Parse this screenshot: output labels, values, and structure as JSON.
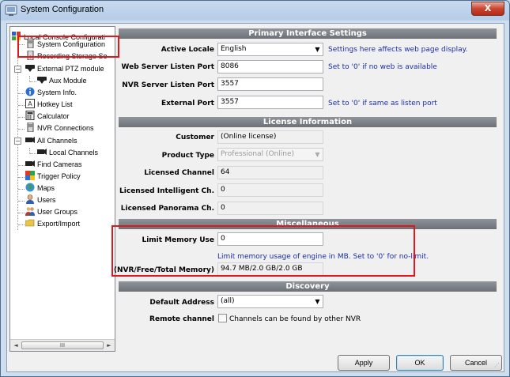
{
  "window": {
    "title": "System Configuration",
    "close_label": "X"
  },
  "tree": {
    "items": [
      {
        "label": "Local Console Configurati",
        "icon": "console-config-icon"
      },
      {
        "label": "System Configuration",
        "icon": "server-icon"
      },
      {
        "label": "Recording Storage Se",
        "icon": "storage-icon"
      },
      {
        "label": "External PTZ module",
        "icon": "ptz-camera-icon"
      },
      {
        "label": "Aux Module",
        "icon": "ptz-camera-icon"
      },
      {
        "label": "System Info.",
        "icon": "info-icon"
      },
      {
        "label": "Hotkey List",
        "icon": "hotkey-icon"
      },
      {
        "label": "Calculator",
        "icon": "calculator-icon"
      },
      {
        "label": "NVR Connections",
        "icon": "server-icon"
      },
      {
        "label": "All Channels",
        "icon": "camera-icon"
      },
      {
        "label": "Local Channels",
        "icon": "camera-icon"
      },
      {
        "label": "Find Cameras",
        "icon": "camera-icon"
      },
      {
        "label": "Trigger Policy",
        "icon": "trigger-policy-icon"
      },
      {
        "label": "Maps",
        "icon": "globe-icon"
      },
      {
        "label": "Users",
        "icon": "user-icon"
      },
      {
        "label": "User Groups",
        "icon": "user-group-icon"
      },
      {
        "label": "Export/Import",
        "icon": "folder-icon"
      }
    ],
    "scroll_left": "◄",
    "scroll_right": "►",
    "scroll_thumb": "III"
  },
  "primary": {
    "header": "Primary Interface Settings",
    "active_locale_label": "Active Locale",
    "active_locale_value": "English",
    "active_locale_hint": "Settings here affects web page display.",
    "web_port_label": "Web Server Listen Port",
    "web_port_value": "8086",
    "web_port_hint": "Set to '0' if no web is available",
    "nvr_port_label": "NVR Server Listen Port",
    "nvr_port_value": "3557",
    "external_port_label": "External Port",
    "external_port_value": "3557",
    "external_port_hint": "Set to '0' if same as listen port"
  },
  "license": {
    "header": "License Information",
    "customer_label": "Customer",
    "customer_value": "(Online license)",
    "product_type_label": "Product Type",
    "product_type_value": "Professional (Online)",
    "licensed_channel_label": "Licensed Channel",
    "licensed_channel_value": "64",
    "licensed_intelligent_label": "Licensed Intelligent Ch.",
    "licensed_intelligent_value": "0",
    "licensed_panorama_label": "Licensed Panorama Ch.",
    "licensed_panorama_value": "0"
  },
  "misc": {
    "header": "Miscellaneous",
    "limit_memory_label": "Limit Memory Use",
    "limit_memory_value": "0",
    "limit_memory_hint": "Limit memory usage of engine in MB. Set to '0' for no-limit.",
    "memory_stats_label": "(NVR/Free/Total Memory)",
    "memory_stats_value": "94.7 MB/2.0 GB/2.0 GB"
  },
  "discovery": {
    "header": "Discovery",
    "default_address_label": "Default Address",
    "default_address_value": "(all)",
    "remote_channel_label": "Remote channel",
    "remote_channel_text": "Channels can be found by other NVR"
  },
  "buttons": {
    "apply": "Apply",
    "ok": "OK",
    "cancel": "Cancel"
  },
  "colors": {
    "highlight": "#e3161c",
    "hint_text": "#1a2ea6",
    "section_header": "#7a7f85"
  }
}
